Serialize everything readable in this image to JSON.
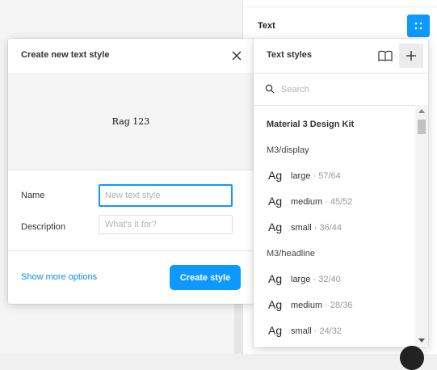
{
  "right_panel": {
    "section_label": "Text"
  },
  "modal": {
    "title": "Create new text style",
    "preview_text": "Rag 123",
    "name_label": "Name",
    "name_placeholder": "New text style",
    "description_label": "Description",
    "description_placeholder": "What's it for?",
    "more_options": "Show more options",
    "create_button": "Create style"
  },
  "styles_panel": {
    "title": "Text styles",
    "search_placeholder": "Search",
    "kit_name": "Material 3 Design Kit",
    "groups": [
      {
        "name": "M3/display",
        "items": [
          {
            "ag": "Ag",
            "name": "large",
            "meta": " · 57/64"
          },
          {
            "ag": "Ag",
            "name": "medium",
            "meta": " · 45/52"
          },
          {
            "ag": "Ag",
            "name": "small",
            "meta": " · 36/44"
          }
        ]
      },
      {
        "name": "M3/headline",
        "items": [
          {
            "ag": "Ag",
            "name": "large",
            "meta": " · 32/40"
          },
          {
            "ag": "Ag",
            "name": "medium",
            "meta": " · 28/36"
          },
          {
            "ag": "Ag",
            "name": "small",
            "meta": " · 24/32"
          }
        ]
      }
    ]
  },
  "colors": {
    "accent": "#0d99ff",
    "link": "#0d8ce9"
  },
  "icons": [
    "close-icon",
    "library-book-icon",
    "plus-icon",
    "search-icon",
    "grid-dots-icon"
  ]
}
